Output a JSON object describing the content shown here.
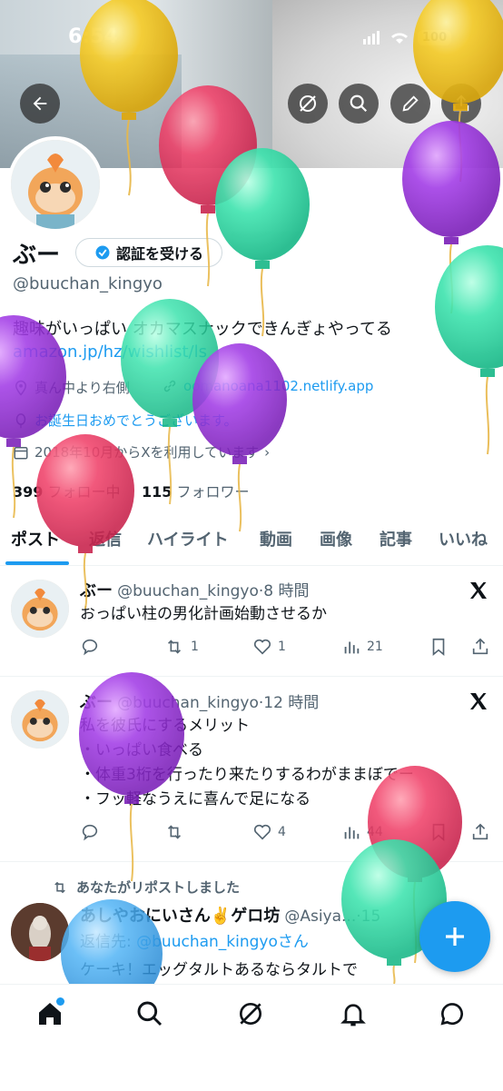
{
  "status_bar": {
    "time": "6:54",
    "battery": "100"
  },
  "profile": {
    "name": "ぶー",
    "verify_label": "認証を受ける",
    "handle": "@buuchan_kingyo",
    "bio": "趣味がいっぱい オカマスナックできんぎょやってる",
    "bio_link": "amazon.jp/hz/wishlist/ls",
    "location": "真ん中より右側",
    "website": "oomanoana1102.netlify.app",
    "birthday": "お誕生日おめでとうございます。",
    "joined": "2018年10月からXを利用しています",
    "following_count": "399",
    "following_label": "フォロー中",
    "followers_count": "115",
    "followers_label": "フォロワー"
  },
  "tabs": [
    "ポスト",
    "返信",
    "ハイライト",
    "動画",
    "画像",
    "記事",
    "いいね"
  ],
  "tweets": [
    {
      "name": "ぶー",
      "handle": "@buuchan_kingyo",
      "time": "8 時間",
      "text": "おっぱい柱の男化計画始動させるか",
      "replies": "",
      "reposts": "1",
      "likes": "1",
      "views": "21"
    },
    {
      "name": "ぶー",
      "handle": "@buuchan_kingyo",
      "time": "12 時間",
      "text_lines": [
        "私を彼氏にするメリット",
        "・いっぱい食べる",
        "・体重3桁を行ったり来たりするわがままぼでー",
        "・フッ軽なうえに喜んで足になる"
      ],
      "replies": "",
      "reposts": "",
      "likes": "4",
      "views": "44"
    },
    {
      "repost_label": "あなたがリポストしました",
      "name": "あしやおにいさん✌️ゲロ坊",
      "handle": "@Asiya...",
      "time": "15",
      "reply_prefix": "返信先: ",
      "reply_to": "@buuchan_kingyoさん",
      "text": "ケーキ！エッグタルトあるならタルトで"
    }
  ],
  "colors": {
    "accent": "#1d9bf0",
    "text": "#0f1419",
    "secondary": "#536471"
  },
  "icons": [
    "back-icon",
    "grok-icon",
    "search-icon",
    "edit-icon",
    "share-icon",
    "verified-icon",
    "location-icon",
    "link-icon",
    "balloon-icon",
    "calendar-icon",
    "x-logo-icon",
    "reply-icon",
    "repost-icon",
    "like-icon",
    "views-icon",
    "bookmark-icon",
    "home-icon",
    "notifications-icon",
    "messages-icon",
    "compose-icon"
  ]
}
